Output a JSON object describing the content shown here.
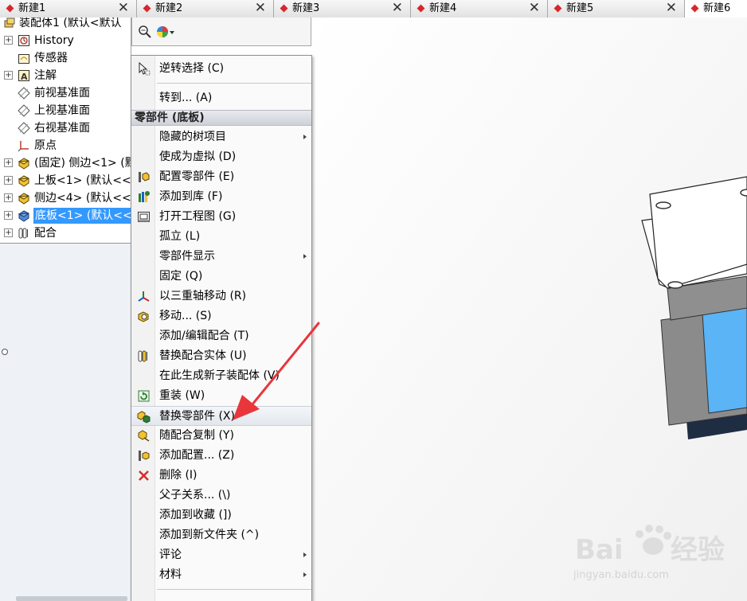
{
  "tabs": [
    {
      "label": "新建1",
      "close": "✕"
    },
    {
      "label": "新建2",
      "close": "✕"
    },
    {
      "label": "新建3",
      "close": "✕"
    },
    {
      "label": "新建4",
      "close": "✕"
    },
    {
      "label": "新建5",
      "close": "✕"
    },
    {
      "label": "新建6",
      "close": ""
    }
  ],
  "tree": {
    "root": "装配体1 (默认<默认",
    "items": [
      {
        "label": "History",
        "icon": "history-icon",
        "expander": "+"
      },
      {
        "label": "传感器",
        "icon": "sensor-icon",
        "expander": ""
      },
      {
        "label": "注解",
        "icon": "annotation-icon",
        "expander": "+"
      },
      {
        "label": "前视基准面",
        "icon": "plane-icon",
        "expander": ""
      },
      {
        "label": "上视基准面",
        "icon": "plane-icon",
        "expander": ""
      },
      {
        "label": "右视基准面",
        "icon": "plane-icon",
        "expander": ""
      },
      {
        "label": "原点",
        "icon": "origin-icon",
        "expander": ""
      },
      {
        "label": "(固定) 侧边<1> (默",
        "icon": "part-icon",
        "expander": "+"
      },
      {
        "label": "上板<1> (默认<<",
        "icon": "part-icon",
        "expander": "+"
      },
      {
        "label": "侧边<4> (默认<<",
        "icon": "part-icon",
        "expander": "+"
      },
      {
        "label": "底板<1> (默认<<",
        "icon": "part-icon",
        "expander": "+",
        "selected": true
      },
      {
        "label": "配合",
        "icon": "mates-icon",
        "expander": "+"
      }
    ]
  },
  "menu": {
    "header": "零部件 (底板)",
    "items_top": [
      {
        "label": "逆转选择 (C)",
        "icon": "cursor-icon"
      },
      {
        "label": "转到... (A)",
        "icon": ""
      }
    ],
    "items": [
      {
        "label": "隐藏的树项目",
        "icon": "",
        "submenu": true
      },
      {
        "label": "使成为虚拟 (D)",
        "icon": ""
      },
      {
        "label": "配置零部件 (E)",
        "icon": "configure-icon"
      },
      {
        "label": "添加到库 (F)",
        "icon": "library-icon"
      },
      {
        "label": "打开工程图 (G)",
        "icon": "drawing-icon"
      },
      {
        "label": "孤立 (L)",
        "icon": ""
      },
      {
        "label": "零部件显示",
        "icon": "",
        "submenu": true
      },
      {
        "label": "固定 (Q)",
        "icon": ""
      },
      {
        "label": "以三重轴移动 (R)",
        "icon": "triad-icon"
      },
      {
        "label": "移动... (S)",
        "icon": "move-icon"
      },
      {
        "label": "添加/编辑配合 (T)",
        "icon": ""
      },
      {
        "label": "替换配合实体 (U)",
        "icon": "replace-mate-icon"
      },
      {
        "label": "在此生成新子装配体 (V)",
        "icon": ""
      },
      {
        "label": "重装 (W)",
        "icon": "reload-icon"
      },
      {
        "label": "替换零部件 (X)",
        "icon": "replace-component-icon"
      },
      {
        "label": "随配合复制 (Y)",
        "icon": "copy-with-mates-icon"
      },
      {
        "label": "添加配置... (Z)",
        "icon": "add-config-icon"
      },
      {
        "label": "删除 (I)",
        "icon": "delete-icon"
      },
      {
        "label": "父子关系... (\\)",
        "icon": ""
      },
      {
        "label": "添加到收藏 (])",
        "icon": ""
      },
      {
        "label": "添加到新文件夹 (^)",
        "icon": ""
      },
      {
        "label": "评论",
        "icon": "",
        "submenu": true
      },
      {
        "label": "材料",
        "icon": "",
        "submenu": true
      }
    ]
  },
  "colors": {
    "accent": "#3399ff",
    "arrow": "#e8363a",
    "tab_marker": "#d8262d",
    "model_blue": "#5ab4f5",
    "model_gray": "#8a8a8a",
    "model_dark": "#1e2c40"
  }
}
